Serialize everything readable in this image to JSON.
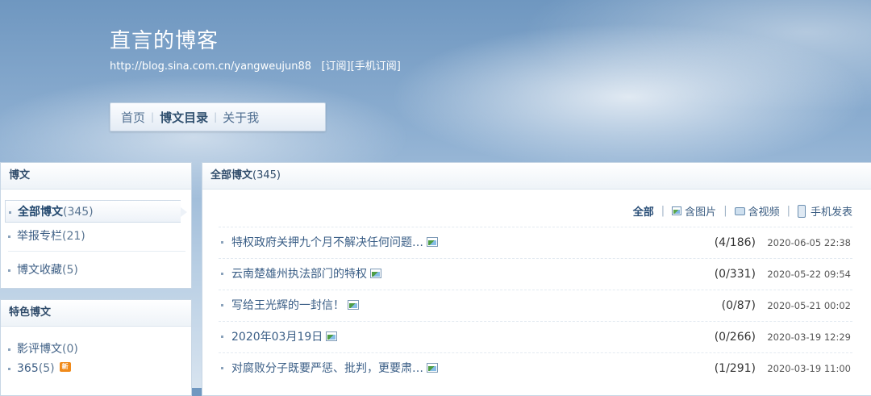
{
  "blog": {
    "title": "直言的博客",
    "url": "http://blog.sina.com.cn/yangweujun88",
    "subscribe": "[订阅]",
    "mobile_subscribe": "[手机订阅]"
  },
  "nav": {
    "items": [
      {
        "label": "首页"
      },
      {
        "label": "博文目录"
      },
      {
        "label": "关于我"
      }
    ],
    "active": "博文目录"
  },
  "sidebar": {
    "posts_panel": {
      "title": "博文",
      "items": [
        {
          "label": "全部博文",
          "count": "(345)",
          "active": true
        },
        {
          "label": "举报专栏",
          "count": "(21)"
        },
        {
          "label": "博文收藏",
          "count": "(5)"
        }
      ]
    },
    "featured_panel": {
      "title": "特色博文",
      "items": [
        {
          "label": "影评博文",
          "count": "(0)"
        },
        {
          "label": "365",
          "count": "(5)",
          "badge": "new-icon"
        }
      ]
    }
  },
  "main": {
    "heading": "全部博文",
    "heading_count": "(345)",
    "filters": [
      "全部",
      "含图片",
      "含视频",
      "手机发表"
    ],
    "articles": [
      {
        "title": "特权政府关押九个月不解决任何问题…",
        "has_image": true,
        "stats": "(4/186)",
        "date": "2020-06-05 22:38"
      },
      {
        "title": "云南楚雄州执法部门的特权",
        "has_image": true,
        "stats": "(0/331)",
        "date": "2020-05-22 09:54"
      },
      {
        "title": "写给王光辉的一封信！",
        "has_image": true,
        "stats": "(0/87)",
        "date": "2020-05-21 00:02"
      },
      {
        "title": "2020年03月19日",
        "has_image": true,
        "stats": "(0/266)",
        "date": "2020-03-19 12:29"
      },
      {
        "title": "对腐败分子既要严惩、批判，更要肃…",
        "has_image": true,
        "stats": "(1/291)",
        "date": "2020-03-19 11:00"
      }
    ]
  }
}
